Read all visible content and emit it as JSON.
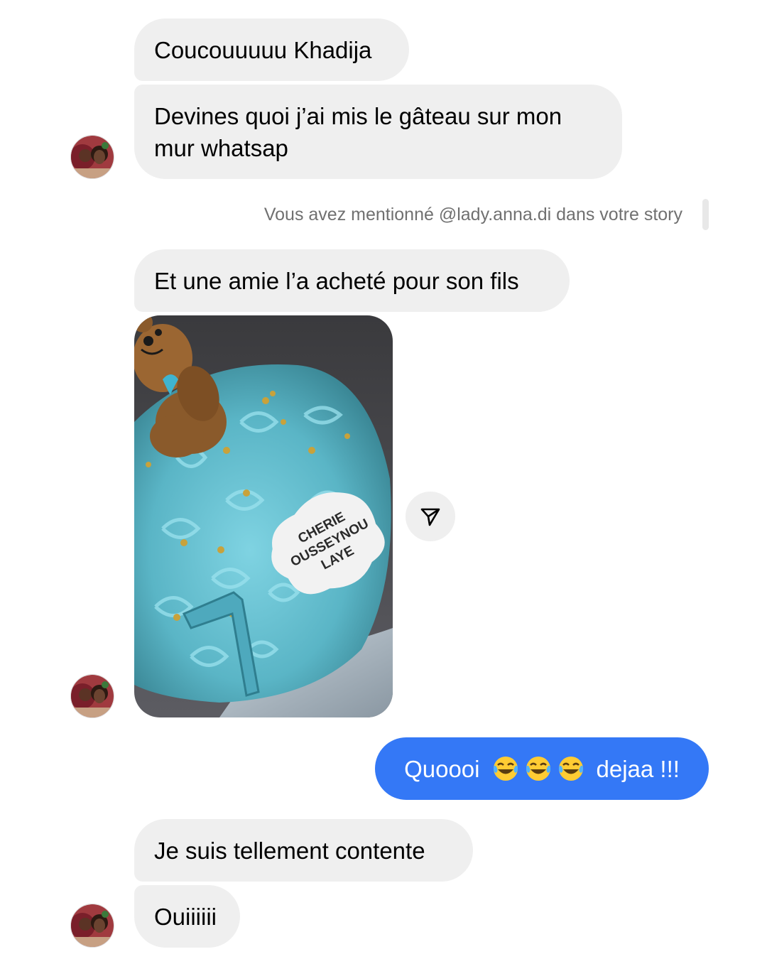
{
  "messages": {
    "m1": "Coucouuuuu Khadija",
    "m2": "Devines quoi j’ai mis le gâteau sur mon mur whatsap",
    "m3": "Et une amie l’a acheté pour son fils",
    "m4_before": "Quoooi",
    "m4_after": "dejaa !!!",
    "m5": "Je suis tellement contente",
    "m6": "Ouiiiiii"
  },
  "story_notice": "Vous avez mentionné @lady.anna.di dans votre story",
  "photo": {
    "topper_lines": [
      "CHERIE",
      "OUSSEYNOU",
      "LAYE"
    ]
  },
  "icons": {
    "share": "send-icon",
    "laugh": "face-with-tears-of-joy"
  },
  "colors": {
    "incoming_bubble": "#efefef",
    "outgoing_bubble": "#3478f6",
    "notice_text": "#707070"
  }
}
